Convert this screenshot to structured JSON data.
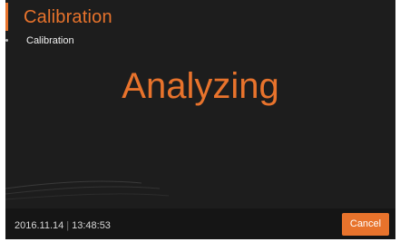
{
  "header": {
    "title": "Calibration",
    "subtitle": "Calibration"
  },
  "main": {
    "status_text": "Analyzing"
  },
  "footer": {
    "date": "2016.11.14",
    "time": "13:48:53",
    "cancel_label": "Cancel"
  },
  "colors": {
    "accent": "#e8732c",
    "background": "#1d1d1d",
    "footer_background": "#151515"
  }
}
